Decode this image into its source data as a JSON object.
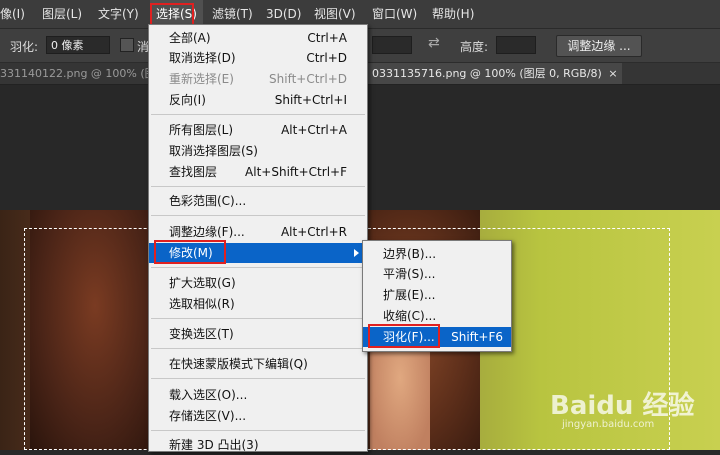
{
  "menubar": {
    "items": [
      "像(I)",
      "图层(L)",
      "文字(Y)",
      "选择(S)",
      "滤镜(T)",
      "3D(D)",
      "视图(V)",
      "窗口(W)",
      "帮助(H)"
    ]
  },
  "options": {
    "feather_label": "羽化:",
    "feather_value": "0 像素",
    "antialias_label": "消",
    "height_label": "高度:",
    "refine_button": "调整边缘 ..."
  },
  "tabs": {
    "left": "331140122.png @ 100% (图",
    "right": "0331135716.png @ 100% (图层 0, RGB/8) *",
    "close": "×"
  },
  "select_menu": {
    "items": [
      {
        "label": "全部(A)",
        "shortcut": "Ctrl+A"
      },
      {
        "label": "取消选择(D)",
        "shortcut": "Ctrl+D"
      },
      {
        "label": "重新选择(E)",
        "shortcut": "Shift+Ctrl+D"
      },
      {
        "label": "反向(I)",
        "shortcut": "Shift+Ctrl+I"
      },
      {
        "label": "所有图层(L)",
        "shortcut": "Alt+Ctrl+A"
      },
      {
        "label": "取消选择图层(S)",
        "shortcut": ""
      },
      {
        "label": "查找图层",
        "shortcut": "Alt+Shift+Ctrl+F"
      },
      {
        "label": "色彩范围(C)...",
        "shortcut": ""
      },
      {
        "label": "调整边缘(F)...",
        "shortcut": "Alt+Ctrl+R"
      },
      {
        "label": "修改(M)",
        "shortcut": ""
      },
      {
        "label": "扩大选取(G)",
        "shortcut": ""
      },
      {
        "label": "选取相似(R)",
        "shortcut": ""
      },
      {
        "label": "变换选区(T)",
        "shortcut": ""
      },
      {
        "label": "在快速蒙版模式下编辑(Q)",
        "shortcut": ""
      },
      {
        "label": "载入选区(O)...",
        "shortcut": ""
      },
      {
        "label": "存储选区(V)...",
        "shortcut": ""
      },
      {
        "label": "新建 3D 凸出(3)",
        "shortcut": ""
      }
    ]
  },
  "modify_submenu": {
    "items": [
      {
        "label": "边界(B)...",
        "shortcut": ""
      },
      {
        "label": "平滑(S)...",
        "shortcut": ""
      },
      {
        "label": "扩展(E)...",
        "shortcut": ""
      },
      {
        "label": "收缩(C)...",
        "shortcut": ""
      },
      {
        "label": "羽化(F)...",
        "shortcut": "Shift+F6"
      }
    ]
  },
  "watermark": {
    "brand": "Baidu 经验",
    "url": "jingyan.baidu.com"
  },
  "colors": {
    "menu_highlight": "#0a64c8",
    "annotation_red": "#e02020"
  }
}
